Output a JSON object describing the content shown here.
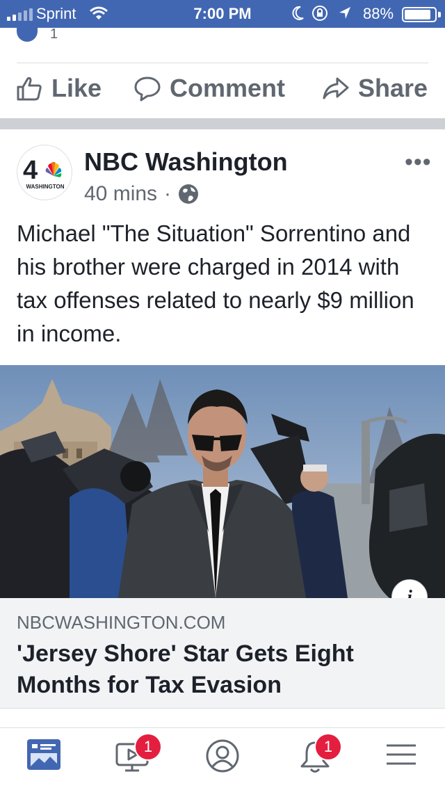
{
  "status_bar": {
    "carrier": "Sprint",
    "time": "7:00 PM",
    "battery": "88%",
    "battery_level": 0.88
  },
  "previous_post": {
    "reaction_count": "1"
  },
  "actions": {
    "like": "Like",
    "comment": "Comment",
    "share": "Share"
  },
  "post": {
    "page_name": "NBC Washington",
    "avatar_text": "WASHINGTON",
    "avatar_number": "4",
    "time": "40 mins",
    "separator": "·",
    "text": "Michael \"The Situation\" Sorrentino and his brother were charged in 2014 with tax offenses related to nearly $9 million in income.",
    "more": "•••"
  },
  "link": {
    "domain": "NBCWASHINGTON.COM",
    "title": "'Jersey Shore' Star Gets Eight Months for Tax Evasion",
    "info": "i"
  },
  "tab_bar": {
    "tabs": [
      {
        "name": "news-feed",
        "icon": "news-feed-icon",
        "active": true
      },
      {
        "name": "watch",
        "icon": "video-icon",
        "badge": "1"
      },
      {
        "name": "profile",
        "icon": "profile-icon"
      },
      {
        "name": "notifications",
        "icon": "bell-icon",
        "badge": "1"
      },
      {
        "name": "menu",
        "icon": "menu-icon"
      }
    ]
  },
  "colors": {
    "brand": "#4267b2",
    "badge": "#e41e3f",
    "text": "#1d2129",
    "secondary": "#606770"
  }
}
